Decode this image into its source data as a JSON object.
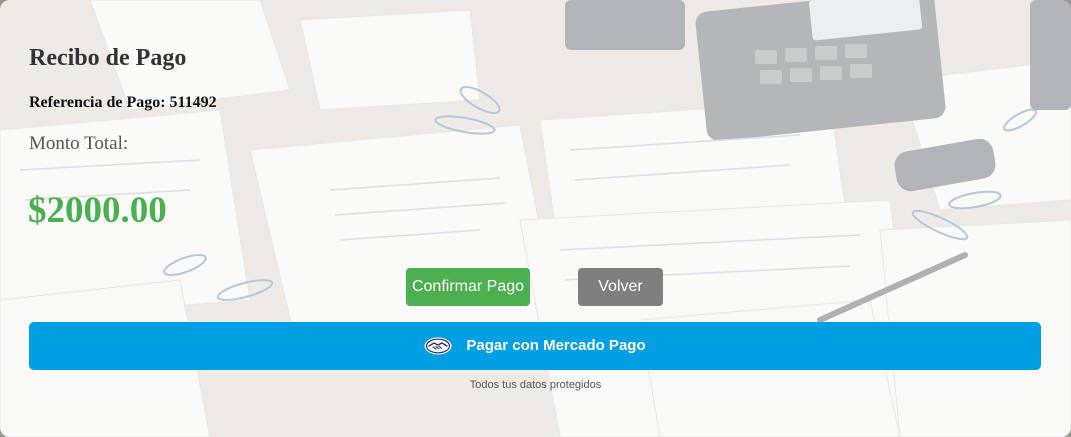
{
  "receipt": {
    "title": "Recibo de Pago",
    "reference": "Referencia de Pago: 511492",
    "total_label": "Monto Total:",
    "amount": "$2000.00"
  },
  "actions": {
    "confirm_label": "Confirmar Pago",
    "back_label": "Volver"
  },
  "mercadopago": {
    "label": "Pagar con Mercado Pago",
    "icon": "handshake-icon",
    "secure_text": "Todos tus datos protegidos"
  },
  "colors": {
    "amount": "#4caf50",
    "confirm": "#4caf50",
    "back": "#7f7f7f",
    "mercadopago": "#009ee3"
  }
}
